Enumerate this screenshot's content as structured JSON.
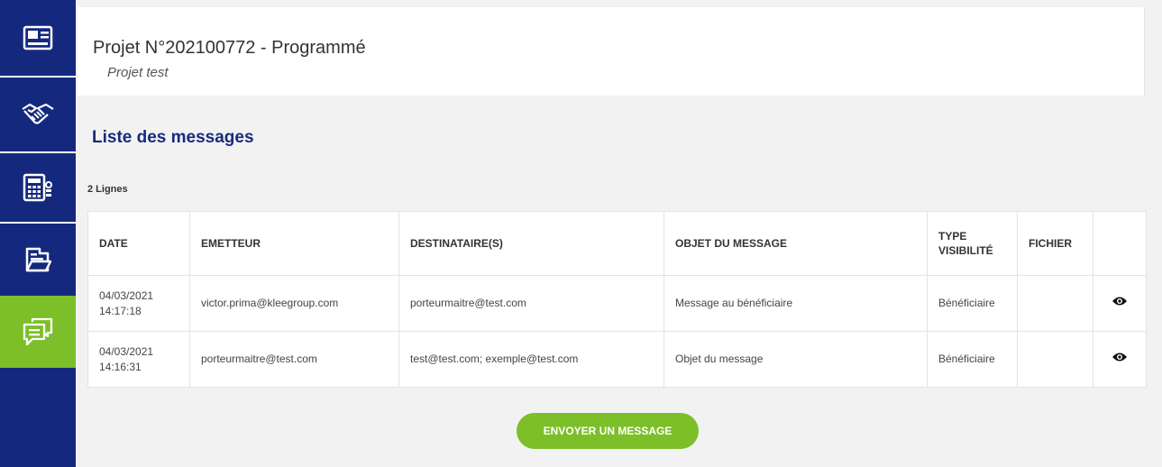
{
  "sidebar": {
    "items": [
      {
        "icon": "id-card-icon",
        "active": false
      },
      {
        "icon": "handshake-icon",
        "active": false
      },
      {
        "icon": "calculator-icon",
        "active": false
      },
      {
        "icon": "folder-icon",
        "active": false
      },
      {
        "icon": "messages-icon",
        "active": true
      }
    ],
    "background": "#14297e",
    "active_color": "#7cbf29"
  },
  "header": {
    "title": "Projet N°202100772 - Programmé",
    "subtitle": "Projet test"
  },
  "messages": {
    "title": "Liste des messages",
    "row_count": "2 Lignes",
    "columns": [
      "DATE",
      "EMETTEUR",
      "DESTINATAIRE(S)",
      "OBJET DU MESSAGE",
      "TYPE VISIBILITÉ",
      "FICHIER",
      ""
    ],
    "rows": [
      {
        "date": "04/03/2021",
        "time": "14:17:18",
        "sender": "victor.prima@kleegroup.com",
        "recipients": "porteurmaitre@test.com",
        "subject": "Message au bénéficiaire",
        "visibility": "Bénéficiaire",
        "file": "",
        "action_icon": "eye-icon"
      },
      {
        "date": "04/03/2021",
        "time": "14:16:31",
        "sender": "porteurmaitre@test.com",
        "recipients": "test@test.com; exemple@test.com",
        "subject": "Objet du message",
        "visibility": "Bénéficiaire",
        "file": "",
        "action_icon": "eye-icon"
      }
    ],
    "send_button_label": "ENVOYER UN MESSAGE"
  }
}
